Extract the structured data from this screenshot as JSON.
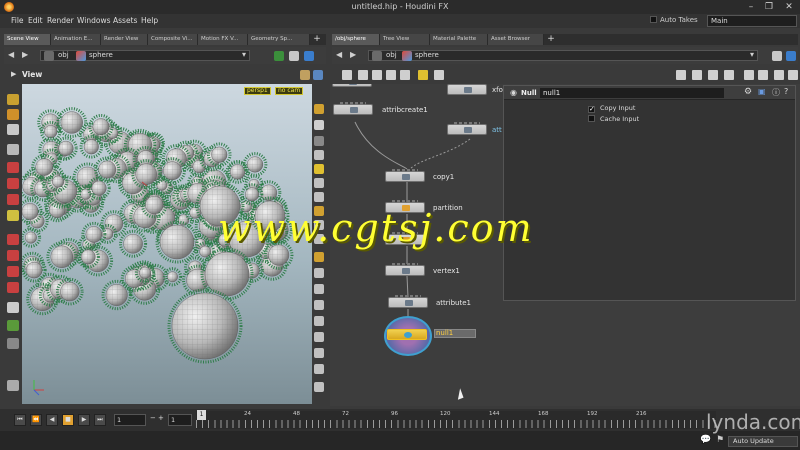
{
  "window": {
    "title": "untitled.hip - Houdini FX"
  },
  "menubar": {
    "items": [
      "File",
      "Edit",
      "Render",
      "Windows",
      "Assets",
      "Help"
    ],
    "auto_takes": "Auto Takes",
    "desktop": "Main"
  },
  "left_pane": {
    "tabs": [
      "Scene View",
      "Animation E...",
      "Render View",
      "Composite Vi...",
      "Motion FX V...",
      "Geometry Sp..."
    ],
    "path": {
      "context": "obj",
      "node": "sphere"
    },
    "view_label": "View",
    "camera_menu": "persp1",
    "cam_menu": "no cam"
  },
  "right_pane": {
    "tabs": [
      "/obj/sphere",
      "Tree View",
      "Material Palette",
      "Asset Browser"
    ],
    "path": {
      "context": "obj",
      "node": "sphere"
    }
  },
  "network": {
    "nodes": [
      {
        "label": "attribcreate1"
      },
      {
        "label": "xfo"
      },
      {
        "label": "att"
      },
      {
        "label": "copy1"
      },
      {
        "label": "partition"
      },
      {
        "label": "vertex1"
      },
      {
        "label": "attribute1"
      },
      {
        "label": "null1"
      }
    ]
  },
  "params": {
    "type": "Null",
    "name": "null1",
    "copy_input": "Copy Input",
    "copy_input_checked": true,
    "cache_input": "Cache Input",
    "cache_input_checked": false
  },
  "timeline": {
    "start_frame": "1",
    "current_frame": "1",
    "end_field": "1",
    "ticks": [
      "1",
      "24",
      "48",
      "72",
      "96",
      "120",
      "144",
      "168",
      "192",
      "216"
    ],
    "auto_update": "Auto Update"
  },
  "watermark": "www.cgtsj.com",
  "brand": "lynda.com",
  "colors": {
    "houdini_orange": "#e07b1a",
    "viewport_sky": "#cdd8e0",
    "null_node_blue": "#3fa0d0",
    "watermark_yellow": "#ffff33"
  }
}
